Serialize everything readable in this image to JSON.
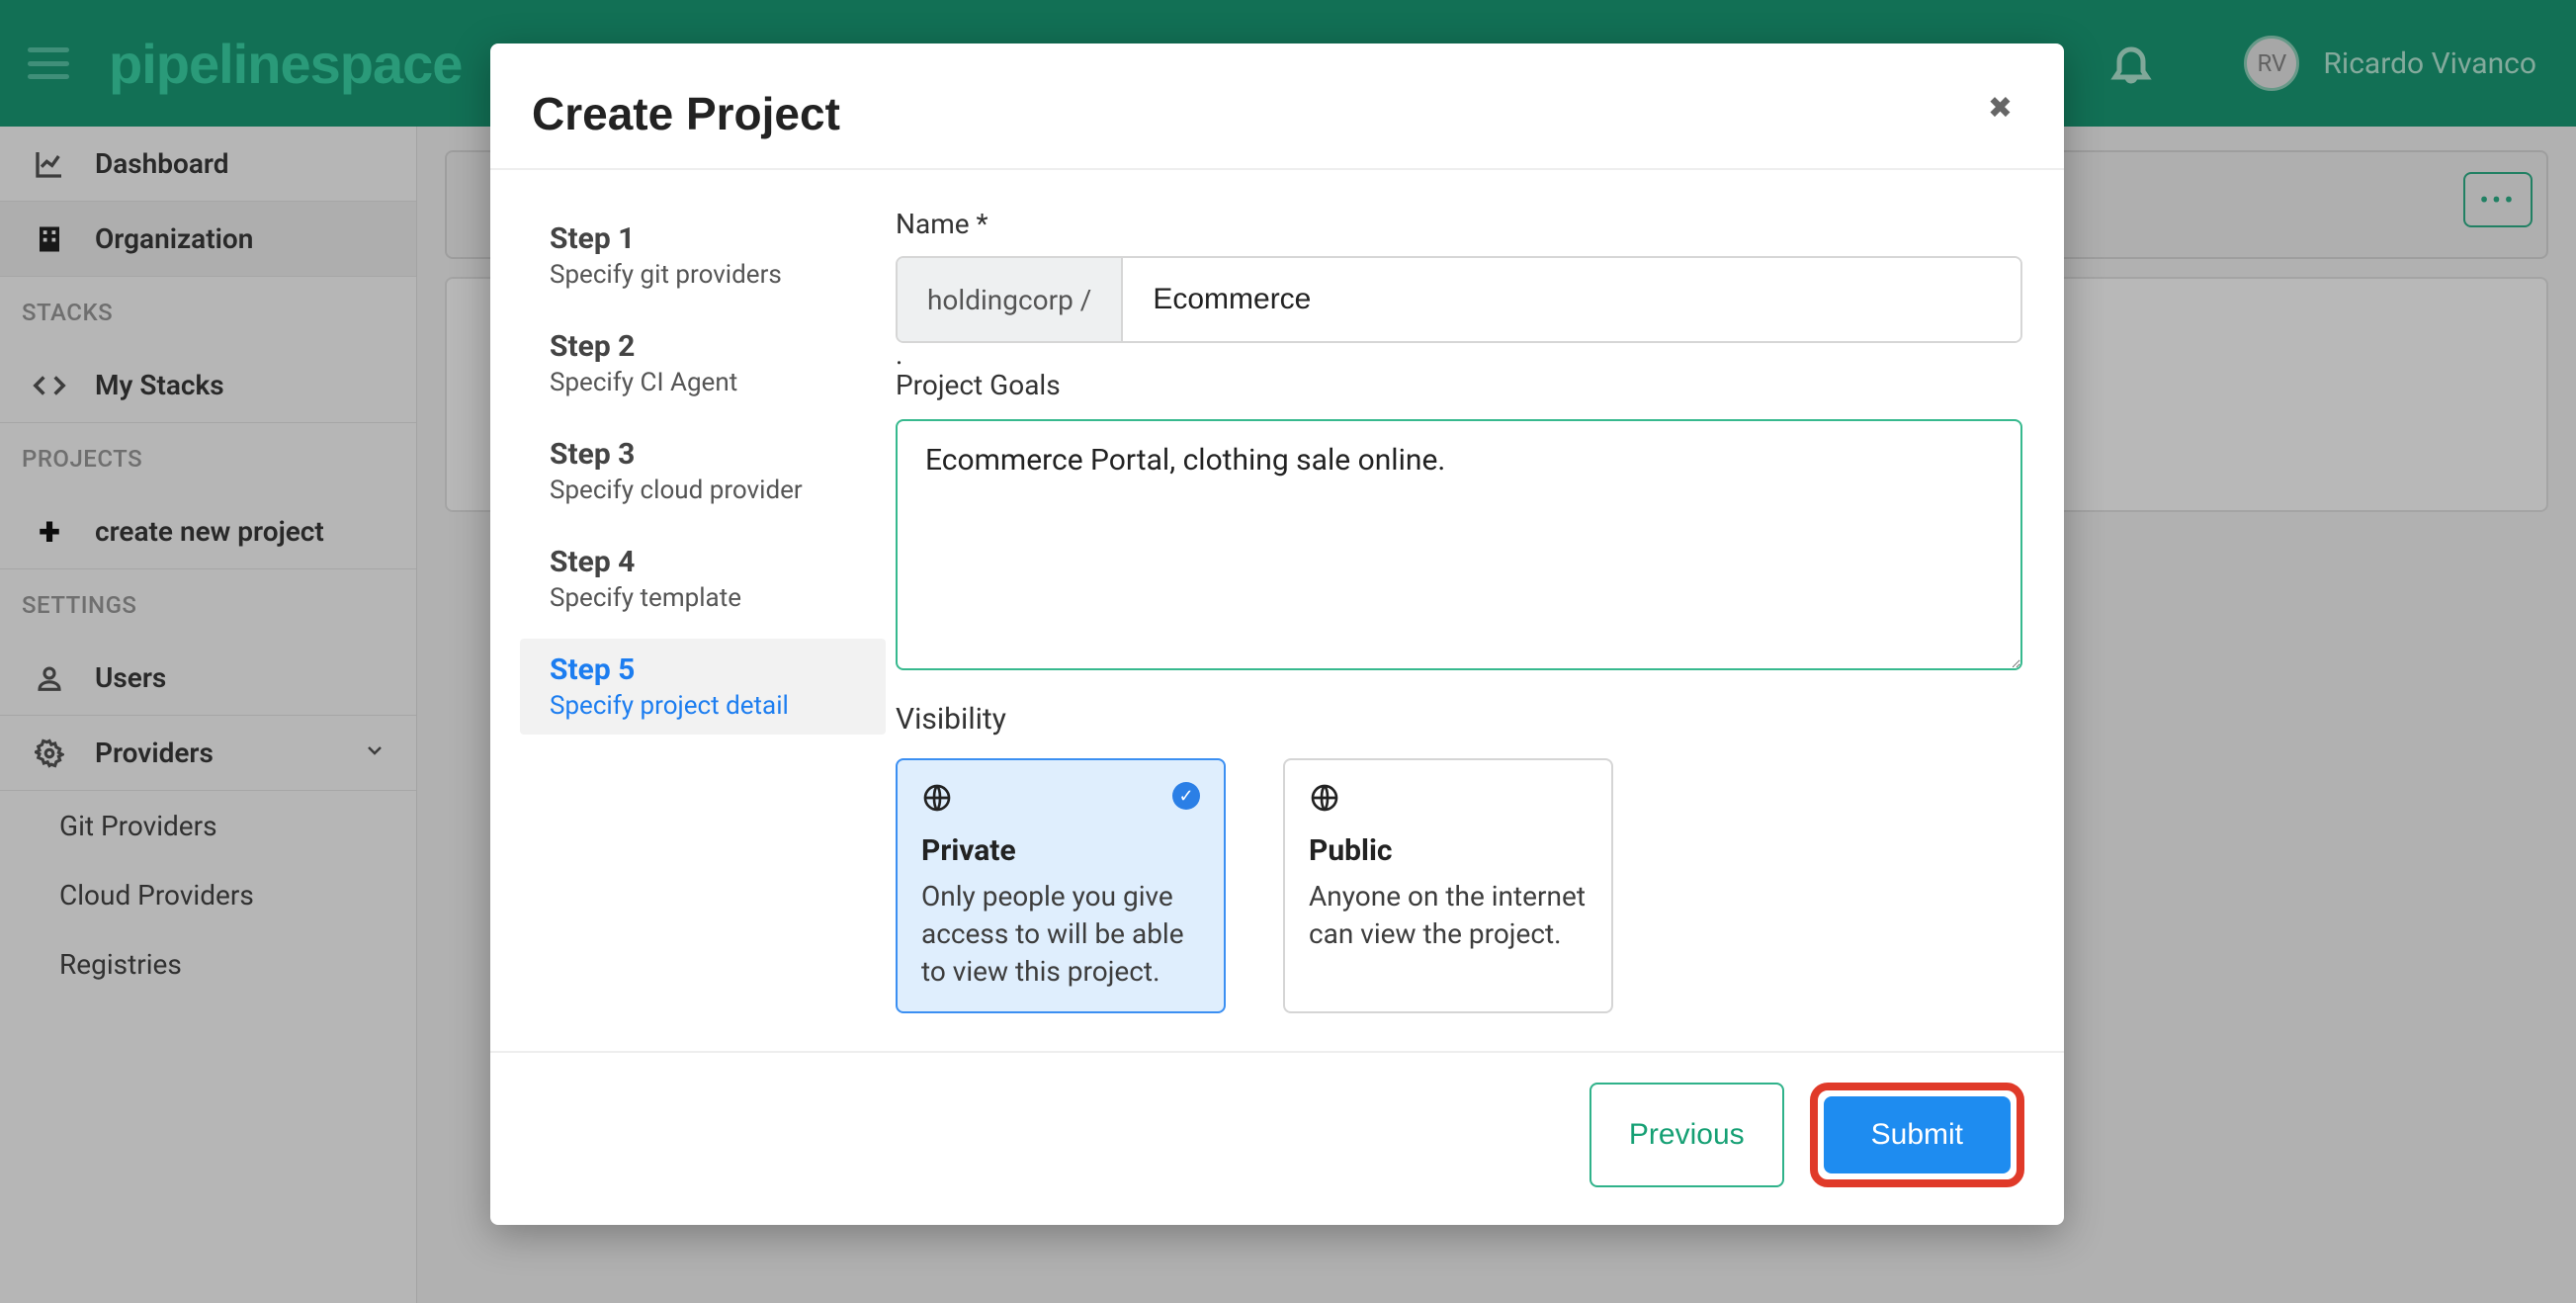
{
  "header": {
    "logo_text": "pipelinespace",
    "user_initials": "RV",
    "user_name": "Ricardo Vivanco"
  },
  "sidebar": {
    "items": [
      {
        "label": "Dashboard",
        "icon": "chart-line-icon"
      },
      {
        "label": "Organization",
        "icon": "building-icon"
      }
    ],
    "heading_stacks": "STACKS",
    "mystacks_label": "My Stacks",
    "heading_projects": "PROJECTS",
    "create_project_label": "create new project",
    "heading_settings": "SETTINGS",
    "users_label": "Users",
    "providers_label": "Providers",
    "provider_children": [
      {
        "label": "Git Providers"
      },
      {
        "label": "Cloud Providers"
      },
      {
        "label": "Registries"
      }
    ]
  },
  "more_btn": "•••",
  "modal": {
    "title": "Create Project",
    "steps": [
      {
        "title": "Step 1",
        "sub": "Specify git providers"
      },
      {
        "title": "Step 2",
        "sub": "Specify CI Agent"
      },
      {
        "title": "Step 3",
        "sub": "Specify cloud provider"
      },
      {
        "title": "Step 4",
        "sub": "Specify template"
      },
      {
        "title": "Step 5",
        "sub": "Specify project detail"
      }
    ],
    "name_label": "Name *",
    "name_prefix": "holdingcorp /",
    "name_value": "Ecommerce",
    "goals_label": "Project Goals",
    "goals_value": "Ecommerce Portal, clothing sale online.",
    "visibility_label": "Visibility",
    "vis_private_title": "Private",
    "vis_private_desc": "Only people you give access to will be able to view this project.",
    "vis_public_title": "Public",
    "vis_public_desc": "Anyone on the internet can view the project.",
    "prev_btn": "Previous",
    "submit_btn": "Submit"
  }
}
